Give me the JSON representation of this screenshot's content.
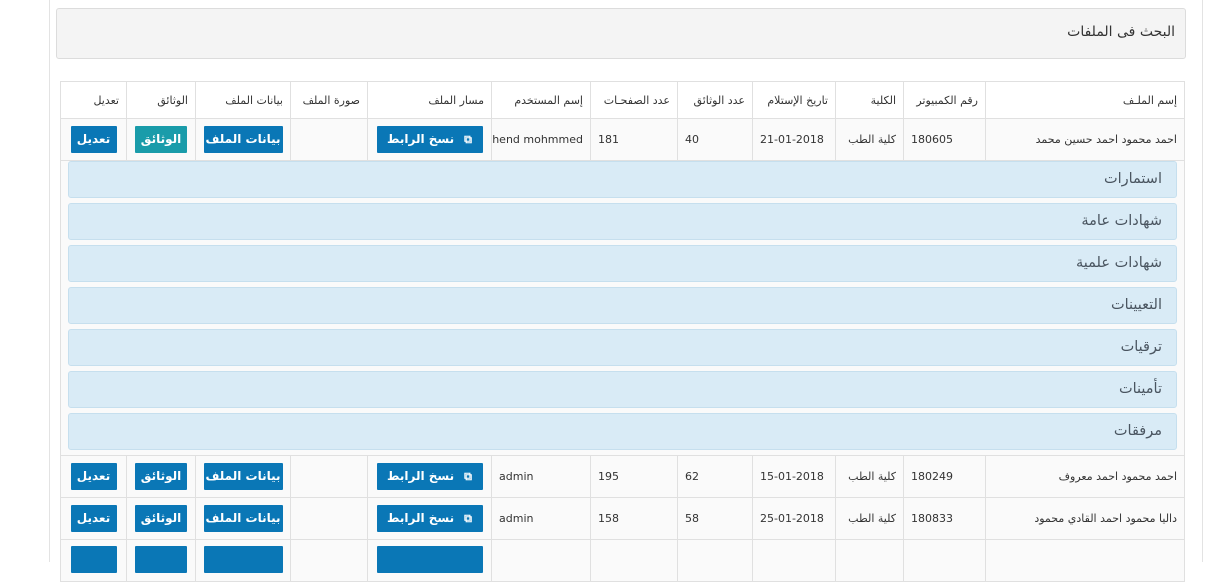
{
  "panel": {
    "title": "البحث فى الملفات"
  },
  "table": {
    "headers": {
      "file_name": "إسم الملـف",
      "computer_no": "رقم الكمبيوتر",
      "college": "الكلية",
      "receive_date": "تاريخ الإستلام",
      "docs_count": "عدد الوثائق",
      "pages_count": "عدد الصفحـات",
      "user_name": "إسم المستخدم",
      "file_path": "مسار الملف",
      "file_image": "صورة الملف",
      "file_data": "بيانات الملف",
      "documents": "الوثائق",
      "edit": "تعديل"
    },
    "buttons": {
      "copy_link": "نسخ الرابط",
      "file_data": "بيانات الملف",
      "documents": "الوثائق",
      "edit": "تعديل"
    },
    "rows": [
      {
        "file_name": "احمد محمود احمد حسين محمد",
        "computer_no": "180605",
        "college": "كلية الطب",
        "receive_date": "21-01-2018",
        "docs_count": "40",
        "pages_count": "181",
        "user_name": "hend mohmmed"
      },
      {
        "file_name": "احمد محمود احمد معروف",
        "computer_no": "180249",
        "college": "كلية الطب",
        "receive_date": "15-01-2018",
        "docs_count": "62",
        "pages_count": "195",
        "user_name": "admin"
      },
      {
        "file_name": "داليا محمود احمد القادي محمود",
        "computer_no": "180833",
        "college": "كلية الطب",
        "receive_date": "25-01-2018",
        "docs_count": "58",
        "pages_count": "158",
        "user_name": "admin"
      }
    ]
  },
  "accordion": {
    "sections": [
      "استمارات",
      "شهادات عامة",
      "شهادات علمية",
      "التعيينات",
      "ترقيات",
      "تأمينات",
      "مرفقات"
    ]
  },
  "icons": {
    "copy": "copy-icon"
  },
  "colors": {
    "primary_button": "#0a77b6",
    "documents_button": "#1a9caa",
    "accordion_bg": "#d9ebf6"
  }
}
